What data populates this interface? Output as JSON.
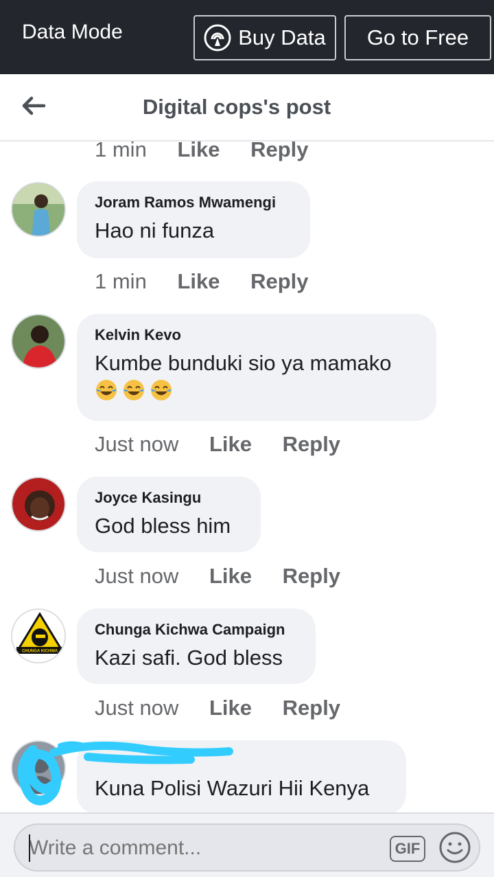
{
  "databar": {
    "mode_label": "Data Mode",
    "buy_label": "Buy Data",
    "free_label": "Go to Free"
  },
  "header": {
    "title": "Digital cops's post"
  },
  "top_meta": {
    "time": "1 min",
    "like": "Like",
    "reply": "Reply"
  },
  "comments": [
    {
      "name": "Joram Ramos Mwamengi",
      "text": "Hao ni funza",
      "time": "1 min",
      "like": "Like",
      "reply": "Reply"
    },
    {
      "name": "Kelvin Kevo",
      "text": "Kumbe bunduki sio ya mamako",
      "emoji": [
        "tears-of-joy",
        "tears-of-joy",
        "tears-of-joy"
      ],
      "time": "Just now",
      "like": "Like",
      "reply": "Reply"
    },
    {
      "name": "Joyce Kasingu",
      "text": "God bless him",
      "time": "Just now",
      "like": "Like",
      "reply": "Reply"
    },
    {
      "name": "Chunga Kichwa Campaign",
      "text": "Kazi safi. God bless",
      "avatar_text": "CHUNGA KICHWA",
      "time": "Just now",
      "like": "Like",
      "reply": "Reply"
    },
    {
      "name": "",
      "text": "Kuna Polisi Wazuri Hii Kenya"
    }
  ],
  "composer": {
    "placeholder": "Write a comment...",
    "gif_label": "GIF"
  },
  "colors": {
    "databar_bg": "#23272d",
    "bubble_bg": "#f0f2f5",
    "meta_text": "#65676b",
    "redaction": "#33ccff"
  }
}
